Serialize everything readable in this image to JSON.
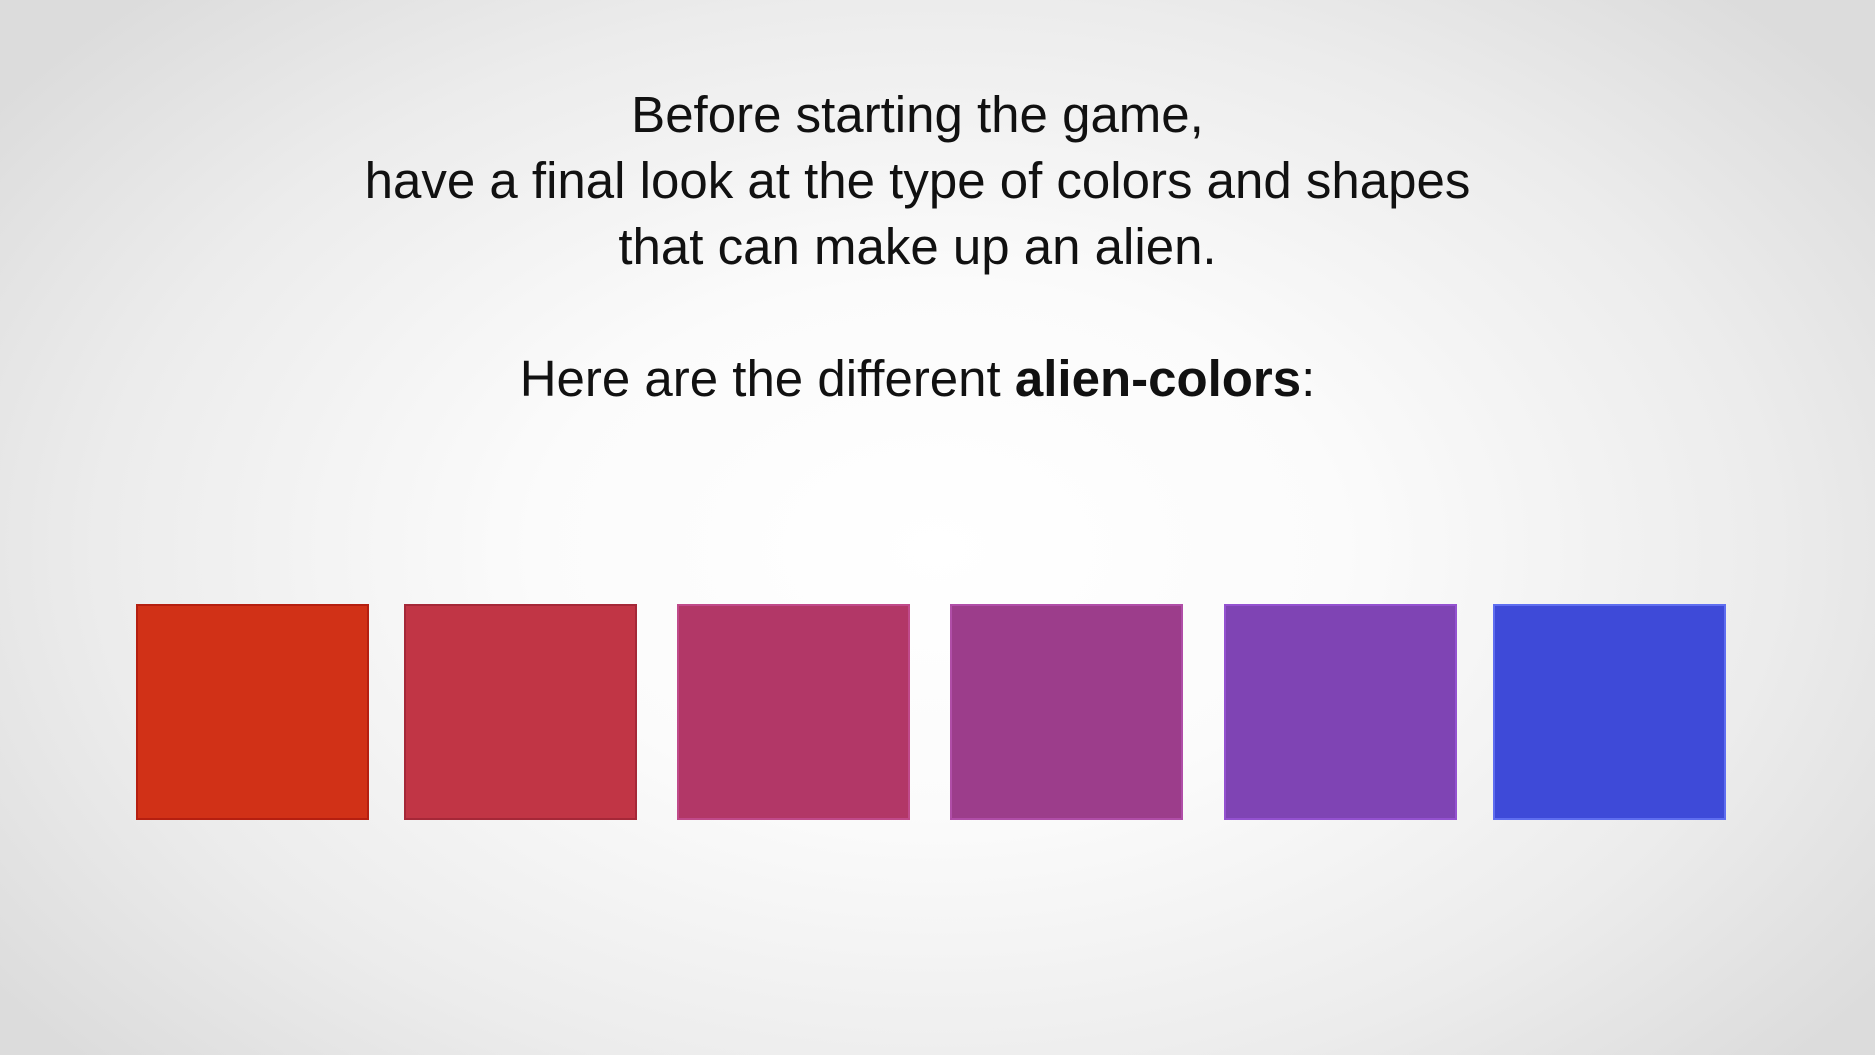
{
  "intro": {
    "lines": [
      "Before starting the game,",
      "have a final look at the type of colors and shapes",
      "that can make up an alien."
    ]
  },
  "heading": {
    "prefix": "Here are the different ",
    "emphasis": "alien-colors",
    "suffix": ":"
  },
  "swatches": [
    {
      "color": "#d13117",
      "border": "#b51f10"
    },
    {
      "color": "#c13545",
      "border": "#a52838"
    },
    {
      "color": "#b23767",
      "border": "#c04a8a"
    },
    {
      "color": "#9c3d8b",
      "border": "#b04ea8"
    },
    {
      "color": "#7f44b4",
      "border": "#9452d0"
    },
    {
      "color": "#3e4ad8",
      "border": "#5f6ef0"
    }
  ]
}
